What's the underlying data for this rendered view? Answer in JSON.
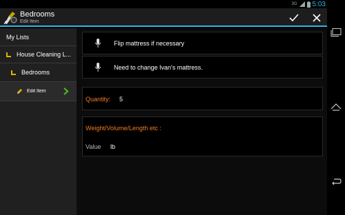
{
  "status": {
    "network": "3G",
    "time": "5:03"
  },
  "actionbar": {
    "title": "Bedrooms",
    "subtitle": "Edit Item"
  },
  "nav": {
    "header": "My Lists",
    "items": [
      {
        "label": "House Cleaning L..."
      },
      {
        "label": "Bedrooms"
      },
      {
        "label": "Edit Item"
      }
    ]
  },
  "main": {
    "notes": [
      {
        "text": "Flip mattress if necessary"
      },
      {
        "text": "Need to change Ivan's mattress."
      }
    ],
    "quantity": {
      "label": "Quantity:",
      "value": "5"
    },
    "weight": {
      "header": "Weight/Volume/Length etc :",
      "label": "Value",
      "unit": "lb"
    }
  },
  "colors": {
    "accent": "#33b5e5",
    "orange": "#f57c1f",
    "folder": "#e3b400",
    "arrow": "#4caf2a"
  },
  "icons": [
    "app-logo-icon",
    "check-icon",
    "close-icon",
    "folder-corner-icon",
    "pencil-icon",
    "chevron-right-icon",
    "microphone-icon",
    "recents-icon",
    "home-icon",
    "back-icon"
  ]
}
